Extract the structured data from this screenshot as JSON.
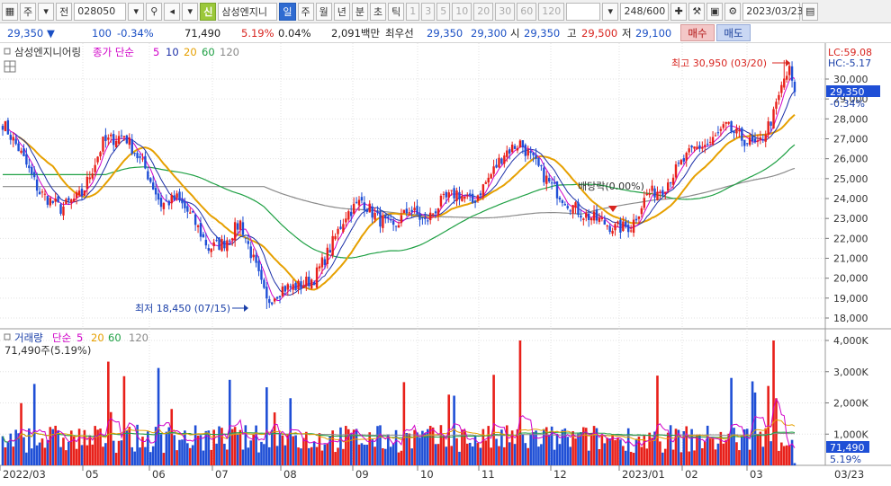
{
  "toolbar": {
    "period_left": "주",
    "period_prev": "전",
    "code": "028050",
    "sin_badge": "신",
    "name": "삼성엔지니",
    "periods": [
      "일",
      "주",
      "월",
      "년",
      "분",
      "초",
      "틱"
    ],
    "minutes": [
      "1",
      "3",
      "5",
      "10",
      "20",
      "30",
      "60",
      "120"
    ],
    "count": "248/600",
    "date": "2023/03/23"
  },
  "quote": {
    "price": "29,350",
    "change": "100",
    "change_pct": "-0.34%",
    "volume": "71,490",
    "turnover_ratio": "5.19%",
    "foreign_pct": "0.04%",
    "amount": "2,091백만",
    "pref_label": "최우선",
    "ask": "29,350",
    "bid": "29,300",
    "open_label": "시",
    "open": "29,350",
    "high_label": "고",
    "high": "29,500",
    "low_label": "저",
    "low": "29,100",
    "buy_label": "매수",
    "sell_label": "매도"
  },
  "price_panel": {
    "name": "삼성엔지니어링",
    "legend_label": "종가 단순",
    "ma_periods": [
      "5",
      "10",
      "20",
      "60",
      "120"
    ],
    "lc": "LC:59.08",
    "hc": "HC:-5.17",
    "current_price": "29,350",
    "current_pct": "-0.34%",
    "annotation_high": "최고 30,950 (03/20)",
    "annotation_low": "최저 18,450 (07/15)",
    "annotation_dividend": "배당락(0.00%)",
    "y_ticks": [
      "30,000",
      "29,000",
      "28,000",
      "27,000",
      "26,000",
      "25,000",
      "24,000",
      "23,000",
      "22,000",
      "21,000",
      "20,000",
      "19,000",
      "18,000"
    ]
  },
  "volume_panel": {
    "label": "거래량",
    "legend_label": "단순",
    "ma_periods": [
      "5",
      "20",
      "60",
      "120"
    ],
    "current_text": "71,490주(5.19%)",
    "current_volume": "71,490",
    "current_pct": "5.19%",
    "y_ticks": [
      "4,000K",
      "3,000K",
      "2,000K",
      "1,000K"
    ]
  },
  "x_axis": {
    "labels": [
      "2022/03",
      "05",
      "06",
      "07",
      "08",
      "09",
      "10",
      "11",
      "12",
      "2023/01",
      "02",
      "03"
    ],
    "right_label": "03/23"
  },
  "colors": {
    "up": "#e8201a",
    "down": "#1f4fd6",
    "ma5": "#d000c8",
    "ma10": "#1c2fa8",
    "ma20": "#e6a000",
    "ma60": "#1fa044",
    "ma120": "#8a8a8a"
  },
  "chart_data": [
    {
      "type": "candlestick",
      "title": "삼성엔지니어링",
      "ylim": [
        18000,
        31000
      ],
      "x_labels": [
        "2022/03",
        "05",
        "06",
        "07",
        "08",
        "09",
        "10",
        "11",
        "12",
        "2023/01",
        "02",
        "03"
      ],
      "series": [
        {
          "name": "종가",
          "x": [
            "2022/03",
            "2022/04",
            "2022/05",
            "2022/06",
            "2022/07",
            "2022/08",
            "2022/09",
            "2022/10",
            "2022/11",
            "2022/12",
            "2023/01",
            "2023/02",
            "2023/03"
          ],
          "values": [
            27500,
            24500,
            26500,
            23500,
            18800,
            22800,
            23200,
            24000,
            26800,
            22800,
            24200,
            26500,
            29350
          ]
        }
      ],
      "high": {
        "value": 30950,
        "date": "03/20"
      },
      "low": {
        "value": 18450,
        "date": "07/15"
      }
    },
    {
      "type": "bar",
      "title": "거래량",
      "ylim": [
        0,
        4300000
      ],
      "ticks": [
        1000000,
        2000000,
        3000000,
        4000000
      ],
      "last_value": 71490
    }
  ]
}
